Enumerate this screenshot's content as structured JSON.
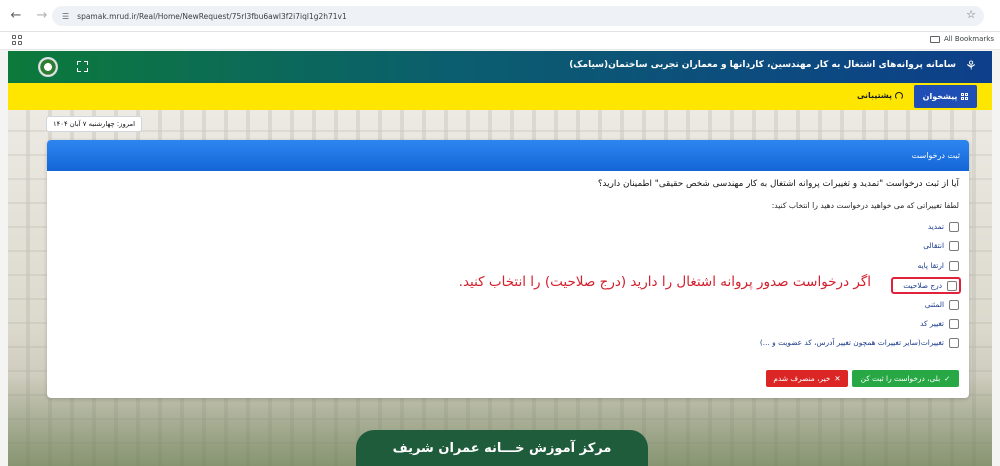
{
  "browser": {
    "url": "spamak.mrud.ir/Real/Home/NewRequest/75rl3fbu6awl3f2i7iql1g2h71v1",
    "bookmarks_label": "All Bookmarks"
  },
  "header": {
    "title": "سامانه پروانه‌های اشتغال به کار مهندسین، کاردانها و معماران تجربی ساختمان(سیامک)",
    "bg_colors": [
      "#0c7a3a",
      "#0d3f8a"
    ]
  },
  "toolbar": {
    "dashboard_label": "پیشخوان",
    "support_label": "پشتیبانی",
    "bg_color": "#ffe600"
  },
  "date_badge": "امروز: چهارشنبه ۷ آبان ۱۴۰۴",
  "card": {
    "title": "ثبت درخواست",
    "question": "آیا از ثبت درخواست \"تمدید و تغییرات پروانه اشتغال به کار مهندسی شخص حقیقی\" اطمینان دارید؟",
    "instruction": "لطفا تغییراتی که می خواهید درخواست دهید را انتخاب کنید:",
    "options": [
      {
        "label": "تمدید",
        "checked": false
      },
      {
        "label": "انتقالی",
        "checked": false
      },
      {
        "label": "ارتقا پایه",
        "checked": false
      },
      {
        "label": "درج صلاحیت",
        "checked": false
      },
      {
        "label": "المثنی",
        "checked": false
      },
      {
        "label": "تغییر کد",
        "checked": false
      },
      {
        "label": "تغییرات(سایر تغییرات همچون تغییر آدرس، کد عضویت و ...)",
        "checked": false
      }
    ],
    "note": "اگر درخواست صدور پروانه اشتغال را دارید (درج صلاحیت) را انتخاب کنید.",
    "submit_label": "بلی، درخواست را ثبت کن",
    "cancel_label": "خیر، منصرف شدم",
    "colors": {
      "header": "#1465d6",
      "submit": "#28a745",
      "cancel": "#dc2626",
      "note": "#d21f2c"
    }
  },
  "banner": {
    "text": "مرکز آموزش خـــانه عمران شریف",
    "bg_color": "#1f5c3c"
  }
}
